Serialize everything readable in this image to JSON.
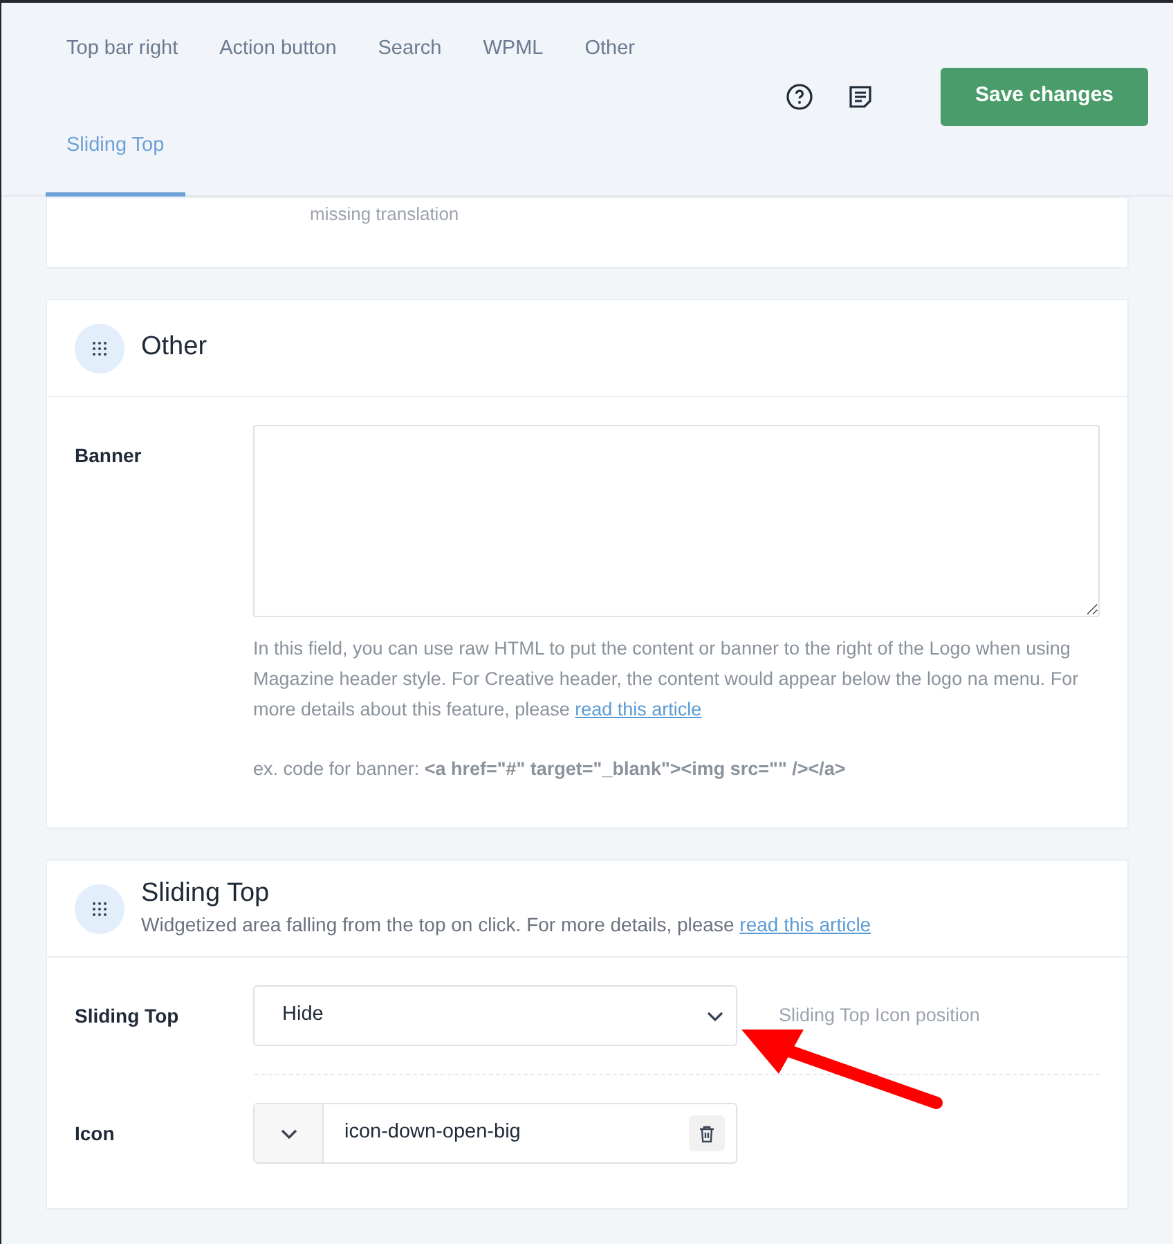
{
  "tabs": [
    {
      "label": "Top bar right",
      "selected": false
    },
    {
      "label": "Action button",
      "selected": false
    },
    {
      "label": "Search",
      "selected": false
    },
    {
      "label": "WPML",
      "selected": false
    },
    {
      "label": "Other",
      "selected": false
    },
    {
      "label": "Sliding Top",
      "selected": true
    }
  ],
  "save_button": "Save changes",
  "top_card": {
    "note": "missing translation"
  },
  "other_section": {
    "title": "Other",
    "banner": {
      "label": "Banner",
      "help_text": "In this field, you can use raw HTML to put the content or banner to the right of the Logo when using Magazine header style. For Creative header, the content would appear below the logo na menu. For more details about this feature, please ",
      "help_link": "read this article",
      "example": "ex. code for banner: **<a href=\"#\" target=\"_blank\"><img src=\"\" /></a>**"
    }
  },
  "sliding_section": {
    "title": "Sliding Top",
    "subtitle": "Widgetized area falling from the top on click. For more details, please ",
    "subtitle_link": "read this article",
    "fields": [
      {
        "kind": "select",
        "label": "Sliding Top",
        "value": "Hide",
        "side_note": "Sliding Top Icon position"
      },
      {
        "kind": "icon",
        "label": "Icon",
        "value": "icon-down-open-big"
      }
    ]
  }
}
